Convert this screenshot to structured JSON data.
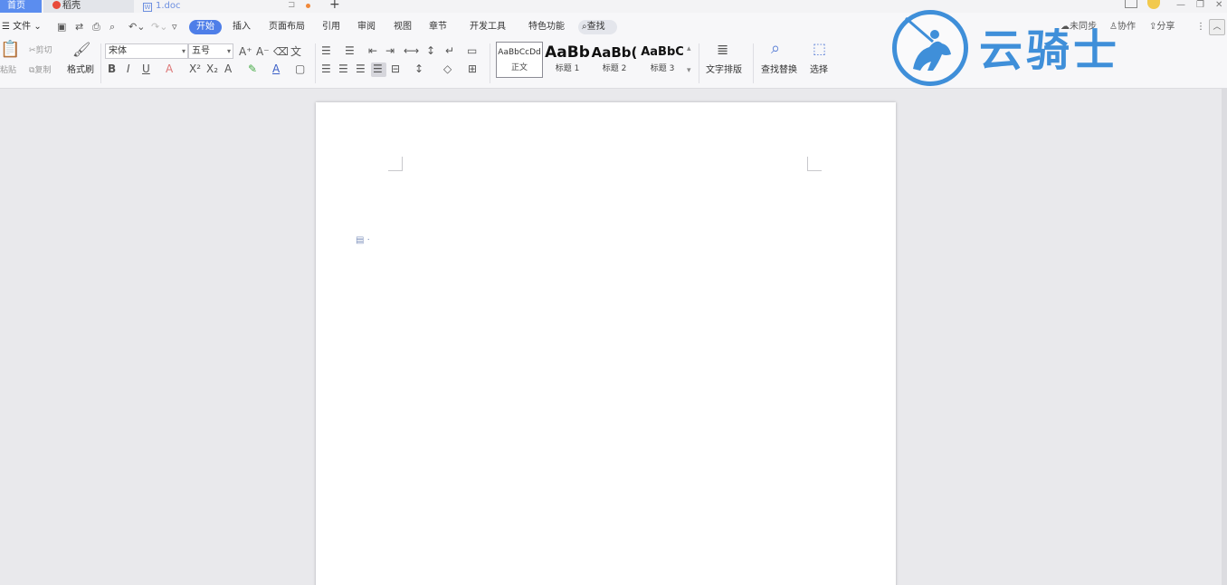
{
  "tabs": {
    "home": "首页",
    "daoke": "稻壳",
    "document": "1.doc",
    "add": "+"
  },
  "menu": {
    "file": "文件",
    "items": [
      "开始",
      "插入",
      "页面布局",
      "引用",
      "审阅",
      "视图",
      "章节",
      "开发工具",
      "特色功能"
    ],
    "search": "查找",
    "sync": "未同步",
    "collaborate": "协作",
    "share": "分享"
  },
  "ribbon": {
    "paste": "粘贴",
    "cut": "剪切",
    "copy": "复制",
    "format_painter": "格式刷",
    "font_name": "宋体",
    "font_size": "五号",
    "styles": [
      {
        "preview": "AaBbCcDd",
        "name": "正文"
      },
      {
        "preview": "AaBb",
        "name": "标题 1"
      },
      {
        "preview": "AaBb(",
        "name": "标题 2"
      },
      {
        "preview": "AaBbC",
        "name": "标题 3"
      }
    ],
    "text_layout": "文字排版",
    "find_replace": "查找替换",
    "select": "选择"
  },
  "watermark": {
    "text": "云骑士"
  },
  "colors": {
    "accent": "#4e7ee8",
    "watermark": "#3f8fd9",
    "home_tab": "#5b8def"
  }
}
